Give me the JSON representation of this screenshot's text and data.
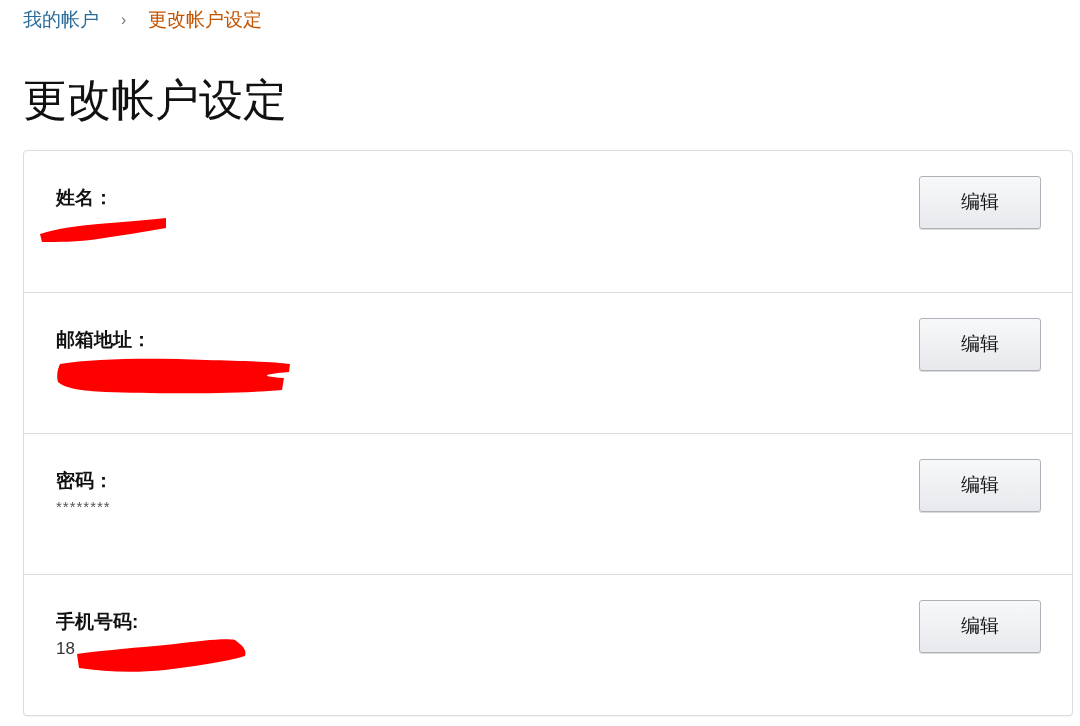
{
  "breadcrumb": {
    "items": [
      {
        "label": "我的帐户",
        "selected": false
      },
      {
        "label": "更改帐户设定",
        "selected": true
      }
    ],
    "separator": "›"
  },
  "title": "更改帐户设定",
  "fields": [
    {
      "label": "姓名：",
      "redacted": true,
      "button": "编辑"
    },
    {
      "label": "邮箱地址：",
      "redacted": true,
      "button": "编辑"
    },
    {
      "label": "密码：",
      "value": "********",
      "redacted": false,
      "button": "编辑"
    },
    {
      "label": "手机号码:",
      "value": "18",
      "redacted": true,
      "button": "编辑"
    }
  ]
}
